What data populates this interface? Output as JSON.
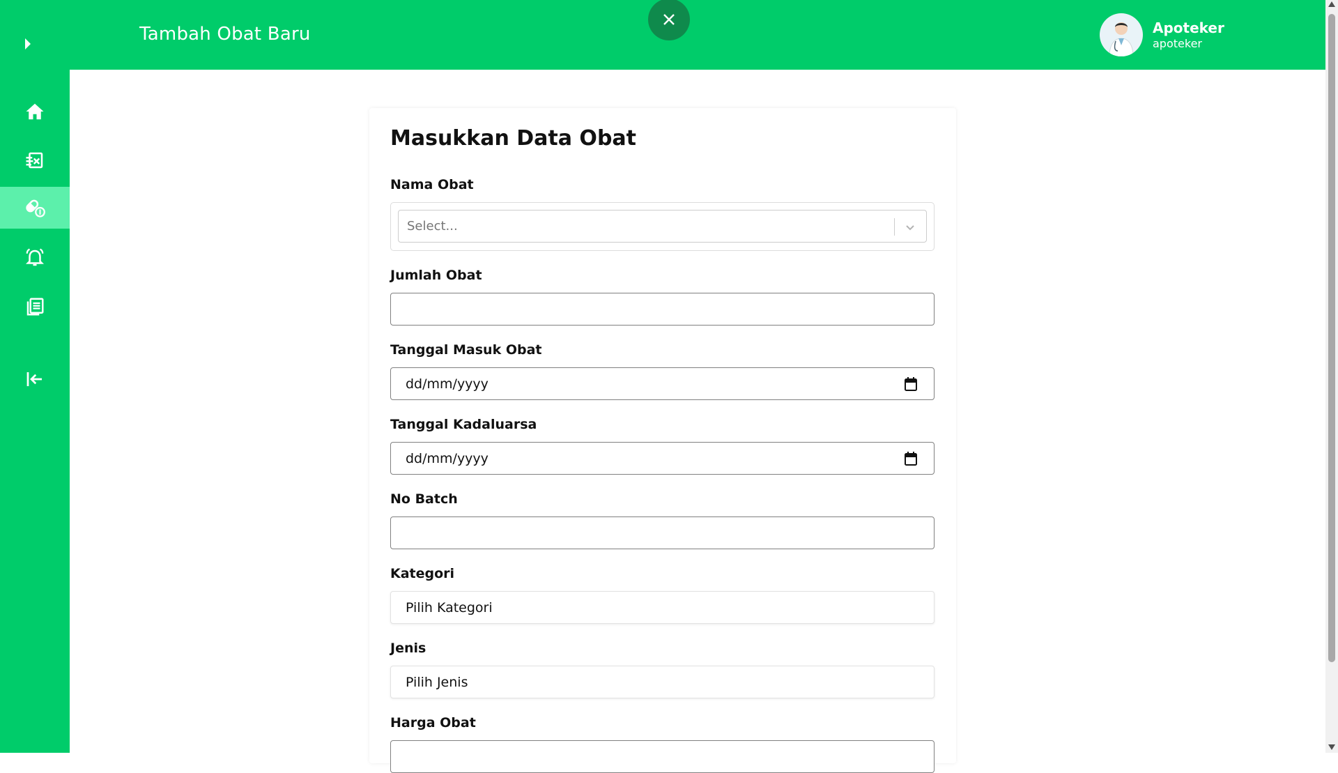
{
  "header": {
    "title": "Tambah Obat Baru",
    "user_name": "Apoteker",
    "user_role": "apoteker"
  },
  "sidebar": {
    "items": [
      {
        "icon": "home-icon",
        "active": false
      },
      {
        "icon": "prescription-icon",
        "active": false
      },
      {
        "icon": "medicine-icon",
        "active": true
      },
      {
        "icon": "alarm-bell-icon",
        "active": false
      },
      {
        "icon": "report-book-icon",
        "active": false
      },
      {
        "icon": "logout-icon",
        "active": false
      }
    ]
  },
  "colors": {
    "primary": "#00cc6a",
    "active_item": "#5cf0ab",
    "close_button": "#0f8a4c"
  },
  "form": {
    "title": "Masukkan Data Obat",
    "nama_obat": {
      "label": "Nama Obat",
      "placeholder": "Select..."
    },
    "jumlah_obat": {
      "label": "Jumlah Obat",
      "value": ""
    },
    "tanggal_masuk": {
      "label": "Tanggal Masuk Obat",
      "value": "dd/mm/yyyy"
    },
    "tanggal_kadaluarsa": {
      "label": "Tanggal Kadaluarsa",
      "value": "dd/mm/yyyy"
    },
    "no_batch": {
      "label": "No Batch",
      "value": ""
    },
    "kategori": {
      "label": "Kategori",
      "value": "Pilih Kategori"
    },
    "jenis": {
      "label": "Jenis",
      "value": "Pilih Jenis"
    },
    "harga_obat": {
      "label": "Harga Obat",
      "value": ""
    }
  }
}
